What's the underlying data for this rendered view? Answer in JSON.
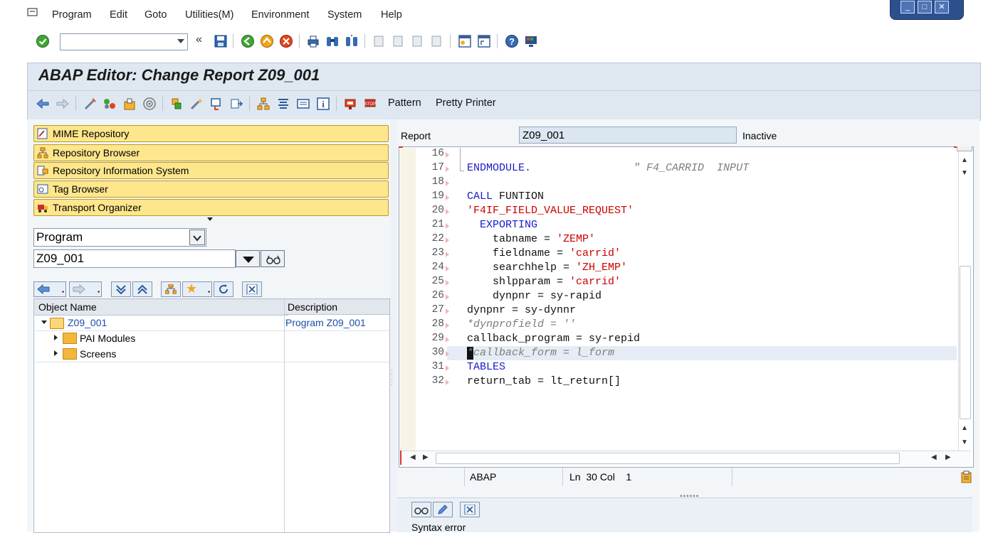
{
  "menu": {
    "items": [
      "Program",
      "Edit",
      "Goto",
      "Utilities(M)",
      "Environment",
      "System",
      "Help"
    ]
  },
  "toolbar": {
    "command_value": ""
  },
  "title": "ABAP Editor: Change Report Z09_001",
  "app_toolbar": {
    "pattern_label": "Pattern",
    "pretty_printer_label": "Pretty Printer"
  },
  "navigator": {
    "buttons": [
      "MIME Repository",
      "Repository Browser",
      "Repository Information System",
      "Tag Browser",
      "Transport Organizer"
    ],
    "object_type": "Program",
    "object_name": "Z09_001"
  },
  "tree": {
    "col_name": "Object Name",
    "col_desc": "Description",
    "root_name": "Z09_001",
    "root_desc": "Program Z09_001",
    "children": [
      "PAI Modules",
      "Screens"
    ]
  },
  "report": {
    "label": "Report",
    "name": "Z09_001",
    "status": "Inactive"
  },
  "editor": {
    "lines": [
      {
        "n": "16",
        "segs": []
      },
      {
        "n": "17",
        "segs": [
          {
            "t": "ENDMODULE.",
            "c": "kw"
          },
          {
            "t": "                \" F4_CARRID  INPUT",
            "c": "cmt"
          }
        ]
      },
      {
        "n": "18",
        "segs": []
      },
      {
        "n": "19",
        "segs": [
          {
            "t": "CALL ",
            "c": "kw"
          },
          {
            "t": "FUNTION",
            "c": "plain"
          }
        ]
      },
      {
        "n": "20",
        "segs": [
          {
            "t": "'F4IF_FIELD_VALUE_REQUEST'",
            "c": "str"
          }
        ]
      },
      {
        "n": "21",
        "segs": [
          {
            "t": "  EXPORTING",
            "c": "kw"
          }
        ]
      },
      {
        "n": "22",
        "segs": [
          {
            "t": "    tabname = ",
            "c": "plain"
          },
          {
            "t": "'ZEMP'",
            "c": "str"
          }
        ]
      },
      {
        "n": "23",
        "segs": [
          {
            "t": "    fieldname = ",
            "c": "plain"
          },
          {
            "t": "'carrid'",
            "c": "str"
          }
        ]
      },
      {
        "n": "24",
        "segs": [
          {
            "t": "    searchhelp = ",
            "c": "plain"
          },
          {
            "t": "'ZH_EMP'",
            "c": "str"
          }
        ]
      },
      {
        "n": "25",
        "segs": [
          {
            "t": "    shlpparam = ",
            "c": "plain"
          },
          {
            "t": "'carrid'",
            "c": "str"
          }
        ]
      },
      {
        "n": "26",
        "segs": [
          {
            "t": "    dynpnr = sy-rapid",
            "c": "plain"
          }
        ]
      },
      {
        "n": "27",
        "segs": [
          {
            "t": "dynpnr = sy-dynnr",
            "c": "plain"
          }
        ]
      },
      {
        "n": "28",
        "segs": [
          {
            "t": "*dynprofield = ''",
            "c": "cmt"
          }
        ]
      },
      {
        "n": "29",
        "segs": [
          {
            "t": "callback_program = sy-repid",
            "c": "plain"
          }
        ]
      },
      {
        "n": "30",
        "segs": [
          {
            "t": "*callback_form = l_form",
            "c": "cmt"
          }
        ]
      },
      {
        "n": "31",
        "segs": [
          {
            "t": "TABLES",
            "c": "kw"
          }
        ]
      },
      {
        "n": "32",
        "segs": [
          {
            "t": "return_tab = lt_return[]",
            "c": "plain"
          }
        ]
      }
    ]
  },
  "editor_status": {
    "language": "ABAP",
    "position": "Ln  30 Col    1"
  },
  "bottom": {
    "message": "Syntax error"
  }
}
